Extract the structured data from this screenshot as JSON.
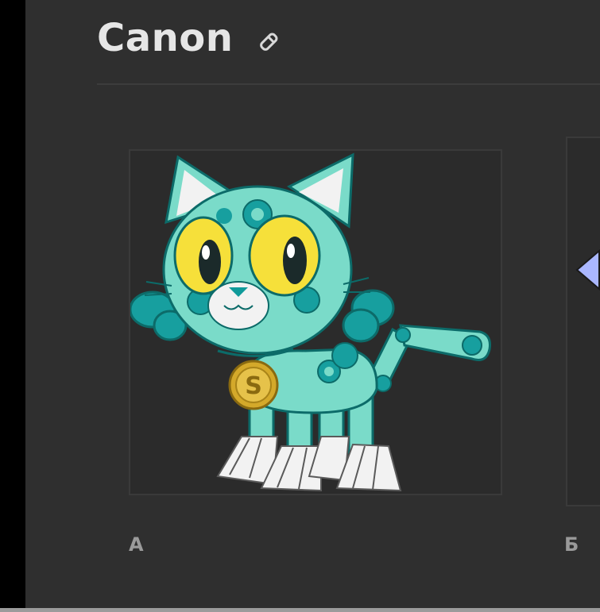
{
  "header": {
    "title": "Canon"
  },
  "costumes": [
    {
      "label": "A"
    },
    {
      "label": "Б"
    }
  ],
  "colors": {
    "panel_bg": "#2f2f2f",
    "card_border": "#3a3a3a",
    "handle_accent": "#aab7ff",
    "character_primary": "#6ad7c7",
    "character_dark": "#0f9a9a",
    "eye_yellow": "#f6e03a",
    "coin_gold": "#d4a92a"
  },
  "icons": {
    "edit": "pencil-icon",
    "handle": "arrow-left-icon"
  }
}
